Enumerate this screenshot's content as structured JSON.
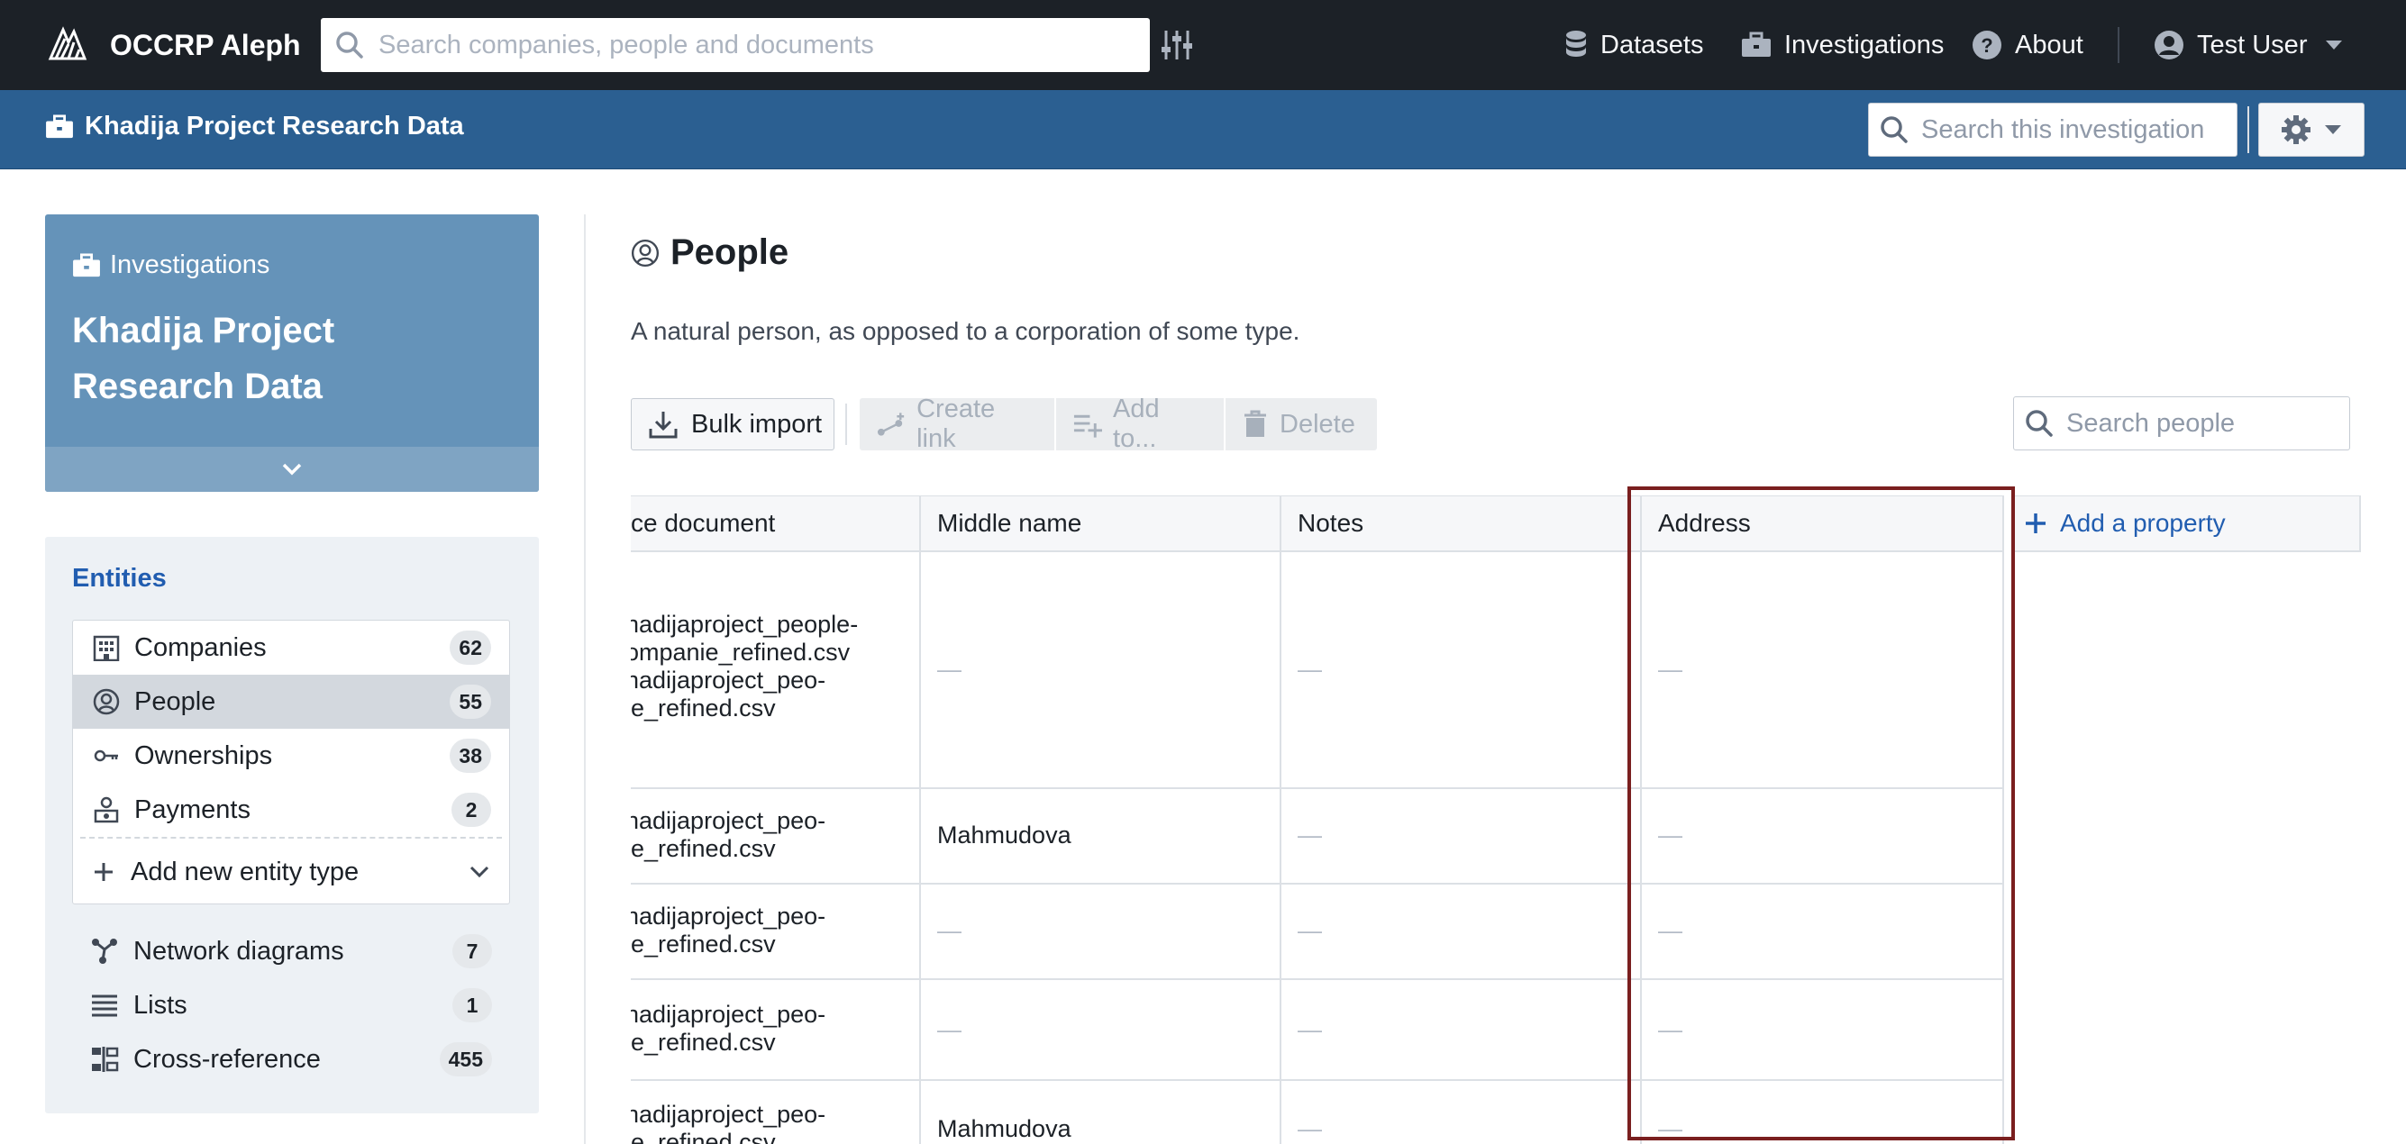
{
  "navbar": {
    "brand": "OCCRP Aleph",
    "search_placeholder": "Search companies, people and documents",
    "items": [
      {
        "label": "Datasets",
        "icon": "database-icon"
      },
      {
        "label": "Investigations",
        "icon": "briefcase-icon"
      },
      {
        "label": "About",
        "icon": "help-icon"
      }
    ],
    "user": "Test User"
  },
  "investigation_bar": {
    "title": "Khadija Project Research Data",
    "search_placeholder": "Search this investigation"
  },
  "sidebar": {
    "card": {
      "kicker": "Investigations",
      "name": "Khadija Project Research Data"
    },
    "entities_heading": "Entities",
    "entities": [
      {
        "label": "Companies",
        "count": "62",
        "icon": "building-icon"
      },
      {
        "label": "People",
        "count": "55",
        "icon": "person-icon",
        "active": true
      },
      {
        "label": "Ownerships",
        "count": "38",
        "icon": "key-icon"
      },
      {
        "label": "Payments",
        "count": "2",
        "icon": "payment-icon"
      }
    ],
    "add_entity_type": "Add new entity type",
    "tools": [
      {
        "label": "Network diagrams",
        "count": "7",
        "icon": "graph-icon"
      },
      {
        "label": "Lists",
        "count": "1",
        "icon": "list-icon"
      },
      {
        "label": "Cross-reference",
        "count": "455",
        "icon": "xref-icon"
      }
    ]
  },
  "main": {
    "title": "People",
    "description": "A natural person, as opposed to a corporation of some type.",
    "toolbar": {
      "bulk_import": "Bulk import",
      "create_link": "Create link",
      "add_to": "Add to...",
      "delete": "Delete",
      "search_placeholder": "Search people"
    },
    "table": {
      "columns": [
        "ce document",
        "Middle name",
        "Notes",
        "Address"
      ],
      "add_property": "Add a property",
      "rows": [
        {
          "doc": [
            "hadijaproject_people-",
            "ompanie_refined.csv",
            "hadijaproject_peo-",
            "le_refined.csv"
          ],
          "middle_name": "—",
          "notes": "—",
          "address": "—"
        },
        {
          "doc": [
            "hadijaproject_peo-",
            "le_refined.csv"
          ],
          "middle_name": "Mahmudova",
          "notes": "—",
          "address": "—"
        },
        {
          "doc": [
            "hadijaproject_peo-",
            "le_refined.csv"
          ],
          "middle_name": "—",
          "notes": "—",
          "address": "—"
        },
        {
          "doc": [
            "hadijaproject_peo-",
            "le_refined.csv"
          ],
          "middle_name": "—",
          "notes": "—",
          "address": "—"
        },
        {
          "doc": [
            "hadijaproject_peo-",
            "le_refined.csv"
          ],
          "middle_name": "Mahmudova",
          "notes": "—",
          "address": "—"
        }
      ]
    }
  },
  "colors": {
    "navbar": "#1c2127",
    "subbar": "#2b5f91",
    "card": "#6593b9",
    "accent": "#215db0",
    "highlight": "#7a1f1f"
  }
}
